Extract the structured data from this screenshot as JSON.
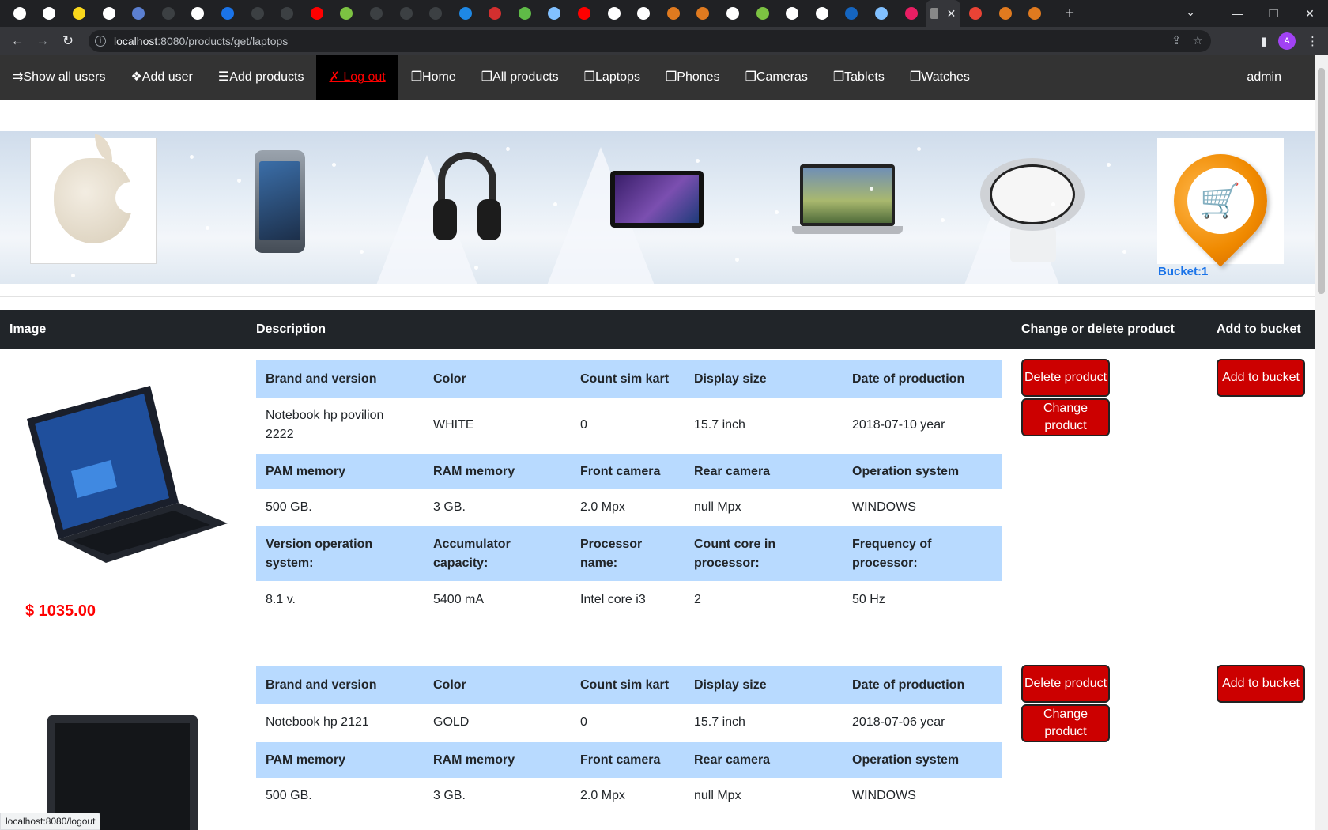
{
  "browser": {
    "tab_favicon_colors": [
      "#ffffff",
      "#ffffff",
      "#f9d71c",
      "#ffffff",
      "#5b7fd1",
      "#3c4043",
      "#ffffff",
      "#1a73e8",
      "#3c4043",
      "#3c4043",
      "#ff0000",
      "#7cc242",
      "#3c4043",
      "#3c4043",
      "#3c4043",
      "#1e88e5",
      "#d32f2f",
      "#5fba47",
      "#81c0ff",
      "#ff0000",
      "#ffffff",
      "#ffffff",
      "#e07a1f",
      "#e07a1f",
      "#ffffff",
      "#7cc242",
      "#ffffff",
      "#ffffff",
      "#1565c0",
      "#81c0ff",
      "#e91e63",
      "#ea4335",
      "#e07a1f",
      "#e07a1f"
    ],
    "new_tab_label": "+",
    "url_host": "localhost",
    "url_path": ":8080/products/get/laptops",
    "profile_initial": "A"
  },
  "nav": {
    "items": [
      "⇉Show all users",
      "❖Add user",
      "☰Add products",
      "✗ Log out",
      "❒Home",
      "❒All products",
      "❒Laptops",
      "❒Phones",
      "❒Cameras",
      "❒Tablets",
      "❒Watches"
    ],
    "user": "admin"
  },
  "banner": {
    "bucket_label": "Bucket:1"
  },
  "table": {
    "headers": {
      "image": "Image",
      "description": "Description",
      "change": "Change or delete product",
      "add": "Add to bucket"
    }
  },
  "buttons": {
    "delete": "Delete product",
    "change": "Change product",
    "add": "Add to bucket"
  },
  "products": [
    {
      "price": "$ 1035.00",
      "rows": [
        [
          "Brand and version",
          "Color",
          "Count sim kart",
          "Display size",
          "Date of production"
        ],
        [
          "Notebook hp povilion 2222",
          "WHITE",
          "0",
          "15.7 inch",
          "2018-07-10 year"
        ],
        [
          "PAM memory",
          "RAM memory",
          "Front camera",
          "Rear camera",
          "Operation system"
        ],
        [
          "500 GB.",
          "3 GB.",
          "2.0 Mpx",
          "null Mpx",
          "WINDOWS"
        ],
        [
          "Version operation system:",
          "Accumulator capacity:",
          "Processor name:",
          "Count core in processor:",
          "Frequency of processor:"
        ],
        [
          "8.1 v.",
          "5400 mA",
          "Intel core i3",
          "2",
          "50 Hz"
        ]
      ]
    },
    {
      "price": "",
      "rows": [
        [
          "Brand and version",
          "Color",
          "Count sim kart",
          "Display size",
          "Date of production"
        ],
        [
          "Notebook hp 2121",
          "GOLD",
          "0",
          "15.7 inch",
          "2018-07-06 year"
        ],
        [
          "PAM memory",
          "RAM memory",
          "Front camera",
          "Rear camera",
          "Operation system"
        ],
        [
          "500 GB.",
          "3 GB.",
          "2.0 Mpx",
          "null Mpx",
          "WINDOWS"
        ]
      ]
    }
  ],
  "status_url": "localhost:8080/logout"
}
